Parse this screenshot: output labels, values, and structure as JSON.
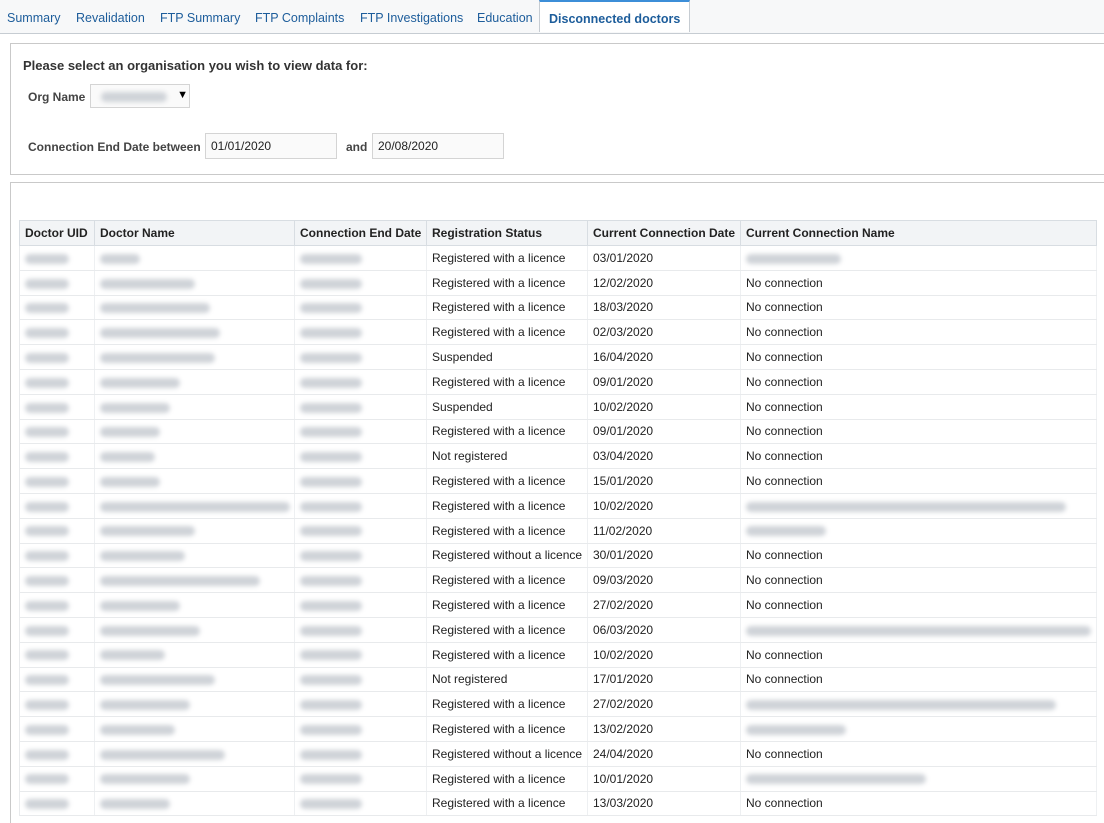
{
  "tabs": [
    {
      "label": "Summary",
      "active": false
    },
    {
      "label": "Revalidation",
      "active": false
    },
    {
      "label": "FTP Summary",
      "active": false
    },
    {
      "label": "FTP Complaints",
      "active": false
    },
    {
      "label": "FTP Investigations",
      "active": false
    },
    {
      "label": "Education",
      "active": false
    },
    {
      "label": "Disconnected doctors",
      "active": true
    }
  ],
  "prompt": {
    "title": "Please select an organisation you wish to view data for:",
    "org_label": "Org Name",
    "date_label": "Connection End Date between",
    "date_from": "01/01/2020",
    "and_label": "and",
    "date_to": "20/08/2020"
  },
  "table": {
    "columns": [
      "Doctor UID",
      "Doctor Name",
      "Connection End Date",
      "Registration Status",
      "Current Connection Date",
      "Current Connection Name"
    ],
    "rows": [
      {
        "status": "Registered with a licence",
        "current_date": "03/01/2020",
        "current_name": ""
      },
      {
        "status": "Registered with a licence",
        "current_date": "12/02/2020",
        "current_name": "No connection"
      },
      {
        "status": "Registered with a licence",
        "current_date": "18/03/2020",
        "current_name": "No connection"
      },
      {
        "status": "Registered with a licence",
        "current_date": "02/03/2020",
        "current_name": "No connection"
      },
      {
        "status": "Suspended",
        "current_date": "16/04/2020",
        "current_name": "No connection"
      },
      {
        "status": "Registered with a licence",
        "current_date": "09/01/2020",
        "current_name": "No connection"
      },
      {
        "status": "Suspended",
        "current_date": "10/02/2020",
        "current_name": "No connection"
      },
      {
        "status": "Registered with a licence",
        "current_date": "09/01/2020",
        "current_name": "No connection"
      },
      {
        "status": "Not registered",
        "current_date": "03/04/2020",
        "current_name": "No connection"
      },
      {
        "status": "Registered with a licence",
        "current_date": "15/01/2020",
        "current_name": "No connection"
      },
      {
        "status": "Registered with a licence",
        "current_date": "10/02/2020",
        "current_name": ""
      },
      {
        "status": "Registered with a licence",
        "current_date": "11/02/2020",
        "current_name": ""
      },
      {
        "status": "Registered without a licence",
        "current_date": "30/01/2020",
        "current_name": "No connection"
      },
      {
        "status": "Registered with a licence",
        "current_date": "09/03/2020",
        "current_name": "No connection"
      },
      {
        "status": "Registered with a licence",
        "current_date": "27/02/2020",
        "current_name": "No connection"
      },
      {
        "status": "Registered with a licence",
        "current_date": "06/03/2020",
        "current_name": ""
      },
      {
        "status": "Registered with a licence",
        "current_date": "10/02/2020",
        "current_name": "No connection"
      },
      {
        "status": "Not registered",
        "current_date": "17/01/2020",
        "current_name": "No connection"
      },
      {
        "status": "Registered with a licence",
        "current_date": "27/02/2020",
        "current_name": ""
      },
      {
        "status": "Registered with a licence",
        "current_date": "13/02/2020",
        "current_name": ""
      },
      {
        "status": "Registered without a licence",
        "current_date": "24/04/2020",
        "current_name": "No connection"
      },
      {
        "status": "Registered with a licence",
        "current_date": "10/01/2020",
        "current_name": ""
      },
      {
        "status": "Registered with a licence",
        "current_date": "13/03/2020",
        "current_name": "No connection"
      }
    ]
  }
}
